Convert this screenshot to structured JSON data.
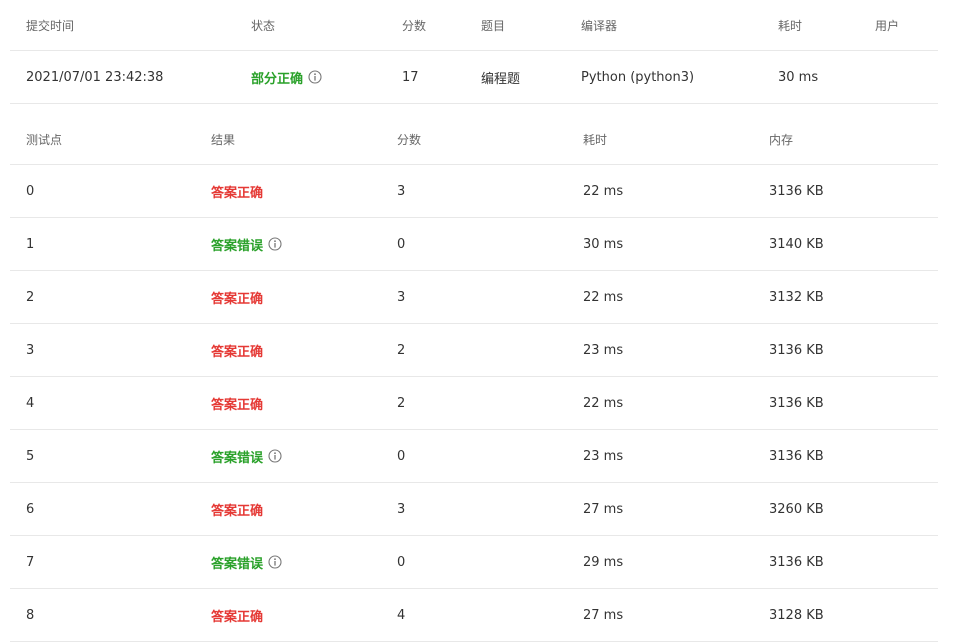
{
  "colors": {
    "accepted": "#e53935",
    "wrong": "#2aa12a",
    "partial": "#2aa12a"
  },
  "submission": {
    "headers": {
      "time": "提交时间",
      "status": "状态",
      "score": "分数",
      "problem": "题目",
      "compiler": "编译器",
      "elapsed": "耗时",
      "user": "用户"
    },
    "row": {
      "time": "2021/07/01 23:42:38",
      "status": "部分正确",
      "status_icon": "info-icon",
      "score": "17",
      "problem": "编程题",
      "compiler": "Python (python3)",
      "elapsed": "30 ms",
      "user": ""
    }
  },
  "cases": {
    "headers": {
      "case": "测试点",
      "result": "结果",
      "score": "分数",
      "elapsed": "耗时",
      "memory": "内存"
    },
    "rows": [
      {
        "case": "0",
        "result": "答案正确",
        "status": "accepted",
        "score": "3",
        "elapsed": "22 ms",
        "memory": "3136 KB"
      },
      {
        "case": "1",
        "result": "答案错误",
        "status": "wrong",
        "score": "0",
        "elapsed": "30 ms",
        "memory": "3140 KB"
      },
      {
        "case": "2",
        "result": "答案正确",
        "status": "accepted",
        "score": "3",
        "elapsed": "22 ms",
        "memory": "3132 KB"
      },
      {
        "case": "3",
        "result": "答案正确",
        "status": "accepted",
        "score": "2",
        "elapsed": "23 ms",
        "memory": "3136 KB"
      },
      {
        "case": "4",
        "result": "答案正确",
        "status": "accepted",
        "score": "2",
        "elapsed": "22 ms",
        "memory": "3136 KB"
      },
      {
        "case": "5",
        "result": "答案错误",
        "status": "wrong",
        "score": "0",
        "elapsed": "23 ms",
        "memory": "3136 KB"
      },
      {
        "case": "6",
        "result": "答案正确",
        "status": "accepted",
        "score": "3",
        "elapsed": "27 ms",
        "memory": "3260 KB"
      },
      {
        "case": "7",
        "result": "答案错误",
        "status": "wrong",
        "score": "0",
        "elapsed": "29 ms",
        "memory": "3136 KB"
      },
      {
        "case": "8",
        "result": "答案正确",
        "status": "accepted",
        "score": "4",
        "elapsed": "27 ms",
        "memory": "3128 KB"
      }
    ]
  }
}
